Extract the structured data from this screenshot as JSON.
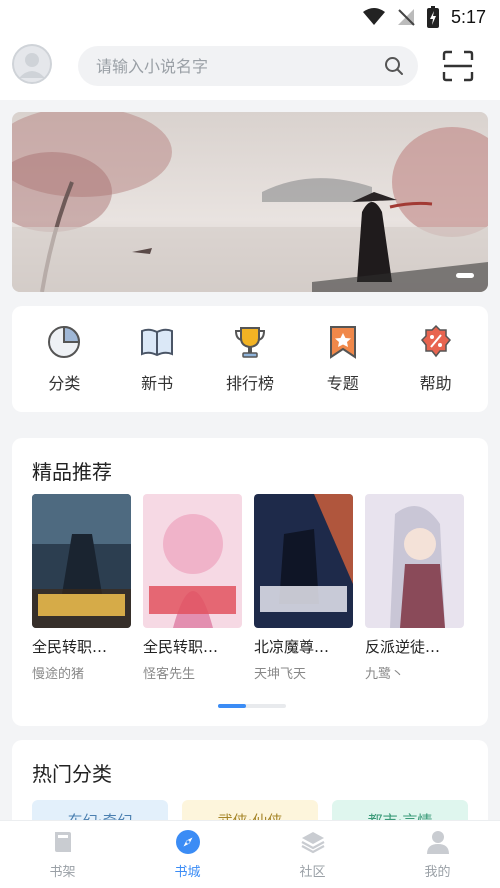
{
  "status_bar": {
    "time": "5:17"
  },
  "header": {
    "search_placeholder": "请输入小说名字"
  },
  "nav": [
    {
      "label": "分类",
      "icon": "pie-chart-icon"
    },
    {
      "label": "新书",
      "icon": "book-open-icon"
    },
    {
      "label": "排行榜",
      "icon": "trophy-icon"
    },
    {
      "label": "专题",
      "icon": "bookmark-star-icon"
    },
    {
      "label": "帮助",
      "icon": "help-badge-icon"
    }
  ],
  "recommend": {
    "title": "精品推荐",
    "books": [
      {
        "title": "全民转职…",
        "author": "慢途的猪",
        "cover_color": "#2c3e50"
      },
      {
        "title": "全民转职…",
        "author": "怪客先生",
        "cover_color": "#f2c4d6"
      },
      {
        "title": "北凉魔尊…",
        "author": "天坤飞天",
        "cover_color": "#1e2a4a"
      },
      {
        "title": "反派逆徒…",
        "author": "九鹭丶",
        "cover_color": "#e8e3ee"
      }
    ]
  },
  "hot": {
    "title": "热门分类",
    "tags": [
      {
        "label": "东幻·奇幻",
        "bg": "#e3f0fb",
        "fg": "#4a7fb0"
      },
      {
        "label": "武侠·仙侠",
        "bg": "#fdf5dc",
        "fg": "#a6862a"
      },
      {
        "label": "都市·言情",
        "bg": "#dff6ee",
        "fg": "#3a9a78"
      }
    ]
  },
  "tabs": [
    {
      "label": "书架",
      "icon": "bookshelf-icon",
      "active": false
    },
    {
      "label": "书城",
      "icon": "compass-icon",
      "active": true
    },
    {
      "label": "社区",
      "icon": "layers-icon",
      "active": false
    },
    {
      "label": "我的",
      "icon": "person-icon",
      "active": false
    }
  ],
  "colors": {
    "accent": "#3b8cf5",
    "icon_orange": "#f0884a",
    "icon_red": "#e8644f",
    "icon_gold": "#f2b324"
  }
}
